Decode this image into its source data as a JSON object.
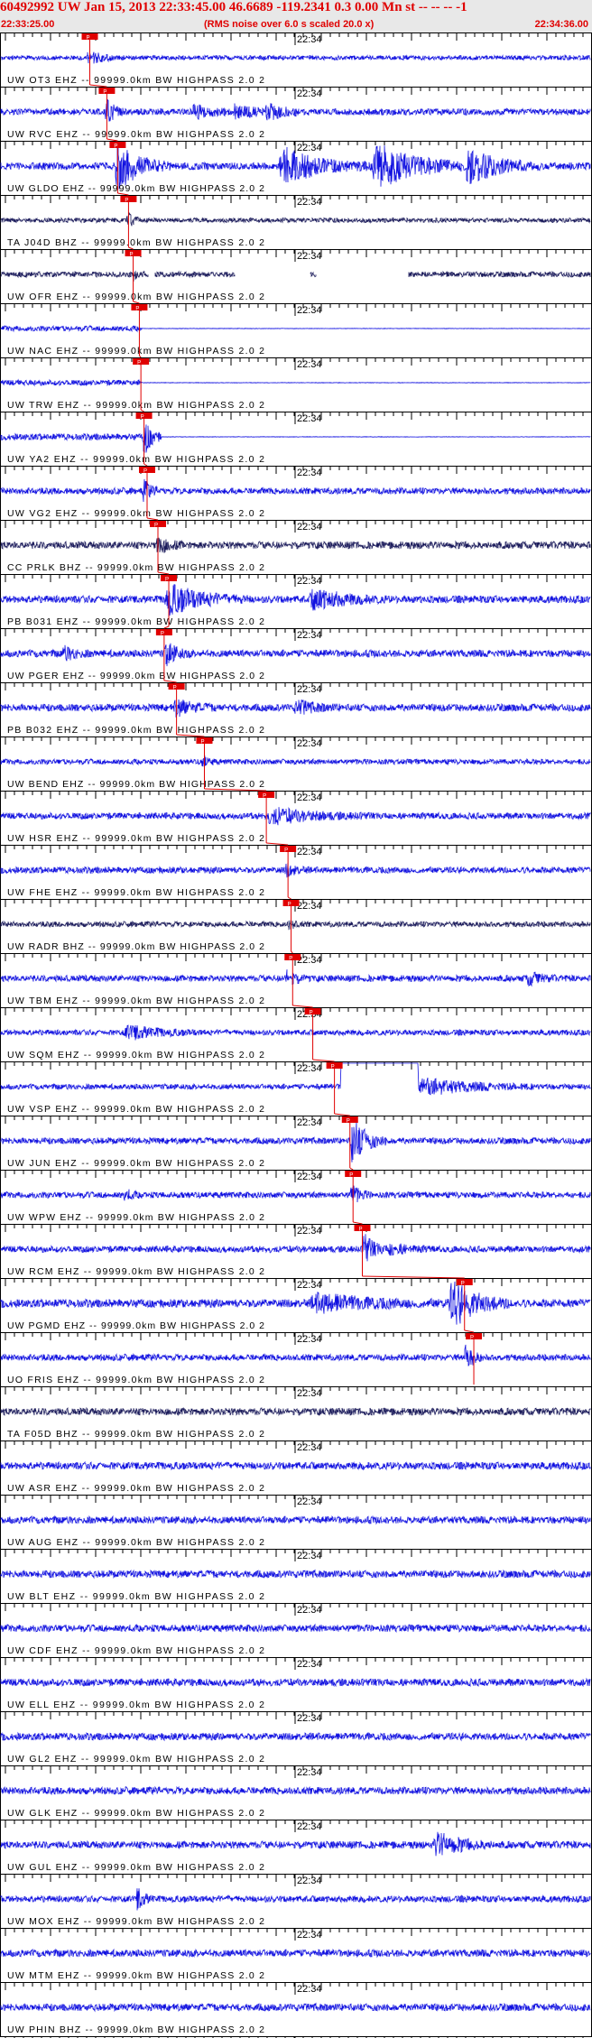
{
  "header": {
    "title": "60492992 UW Jan 15, 2013 22:33:45.00   46.6689 -119.2341  0.3 0.00 Mn st -- -- -- -1",
    "start_time": "22:33:25.00",
    "note": "(RMS noise over 6.0 s scaled 20.0 x)",
    "end_time": "22:34:36.00"
  },
  "chart_data": {
    "type": "line",
    "title": "60492992 UW Jan 15, 2013 22:33:45.00   46.6689 -119.2341  0.3 0.00 Mn st -- -- -- -1",
    "x_start": "22:33:25.00",
    "x_end": "22:34:36.00",
    "minute_label": "22:34",
    "pick_label": "P",
    "grid": false,
    "colors": {
      "trace_blue": "#1010e0",
      "trace_dark": "#1a1a5a",
      "pick": "#e00000",
      "axis": "#000000",
      "header_bg": "#e8e8e8"
    },
    "traces": [
      {
        "label": "UW OT3 EHZ -- 99999.0km BW  HIGHPASS  2.0  2",
        "pick_s": 29.0,
        "color": "blue",
        "amp": 0.25,
        "bursts": [
          [
            28,
            40,
            3.5
          ]
        ]
      },
      {
        "label": "UW RVC EHZ -- 99999.0km BW  HIGHPASS  2.0  2",
        "pick_s": 34.5,
        "color": "blue",
        "amp": 0.35,
        "bursts": [
          [
            34,
            40,
            6
          ],
          [
            62,
            76,
            2.5
          ],
          [
            75,
            90,
            3
          ],
          [
            85,
            100,
            3
          ]
        ]
      },
      {
        "label": "UW GLDO EHZ -- 99999.0km BW  HIGHPASS  2.0  2",
        "pick_s": 38.0,
        "color": "blue",
        "amp": 0.4,
        "bursts": [
          [
            37,
            55,
            8
          ],
          [
            90,
            120,
            6
          ],
          [
            120,
            155,
            7
          ],
          [
            150,
            175,
            6
          ]
        ]
      },
      {
        "label": "TA J04D BHZ -- 99999.0km BW  HIGHPASS  2.0  2",
        "pick_s": 41.5,
        "color": "dark",
        "amp": 0.25,
        "bursts": [
          [
            41,
            46,
            4
          ]
        ]
      },
      {
        "label": "UW OFR EHZ -- 99999.0km BW  HIGHPASS  2.0  2",
        "pick_s": 43.0,
        "color": "dark",
        "amp": 0.3,
        "gaps": [
          [
            48,
            50
          ],
          [
            76,
            100
          ],
          [
            102,
            132
          ]
        ],
        "bursts": [
          [
            43,
            45,
            3
          ]
        ]
      },
      {
        "label": "UW NAC EHZ -- 99999.0km BW  HIGHPASS  2.0  2",
        "pick_s": 45.0,
        "color": "blue",
        "amp": 0.3,
        "flat_after": 46
      },
      {
        "label": "UW TRW EHZ -- 99999.0km BW  HIGHPASS  2.0  2",
        "pick_s": 45.5,
        "color": "blue",
        "amp": 0.3,
        "flat_after": 46
      },
      {
        "label": "UW YA2 EHZ -- 99999.0km BW  HIGHPASS  2.0  2",
        "pick_s": 46.5,
        "color": "blue",
        "amp": 0.35,
        "flat_after": 52,
        "bursts": [
          [
            46,
            52,
            8
          ]
        ]
      },
      {
        "label": "UW VG2 EHZ -- 99999.0km BW  HIGHPASS  2.0  2",
        "pick_s": 47.5,
        "color": "blue",
        "amp": 0.35,
        "bursts": [
          [
            46,
            52,
            4
          ]
        ]
      },
      {
        "label": "CC PRLK BHZ -- 99999.0km BW  HIGHPASS  2.0  2",
        "pick_s": 51.0,
        "color": "dark",
        "amp": 0.4,
        "bursts": [
          [
            50,
            60,
            3
          ]
        ]
      },
      {
        "label": "PB B031 EHZ -- 99999.0km BW  HIGHPASS  2.0  2",
        "pick_s": 54.5,
        "color": "blue",
        "amp": 0.4,
        "bursts": [
          [
            53,
            80,
            5
          ],
          [
            100,
            125,
            3.5
          ]
        ]
      },
      {
        "label": "UW PGER EHZ -- 99999.0km BW  HIGHPASS  2.0  2",
        "pick_s": 53.0,
        "color": "blue",
        "amp": 0.4,
        "bursts": [
          [
            20,
            30,
            2
          ],
          [
            53,
            62,
            4
          ]
        ]
      },
      {
        "label": "PB B032 EHZ -- 99999.0km BW  HIGHPASS  2.0  2",
        "pick_s": 57.0,
        "color": "blue",
        "amp": 0.4,
        "bursts": [
          [
            56,
            70,
            2.5
          ],
          [
            95,
            110,
            2
          ]
        ]
      },
      {
        "label": "UW BEND EHZ -- 99999.0km BW  HIGHPASS  2.0  2",
        "pick_s": 66.0,
        "color": "blue",
        "amp": 0.3,
        "bursts": [
          [
            65,
            70,
            3
          ]
        ]
      },
      {
        "label": "UW HSR EHZ -- 99999.0km BW  HIGHPASS  2.0  2",
        "pick_s": 86.0,
        "color": "blue",
        "amp": 0.35,
        "bursts": [
          [
            86,
            120,
            2.8
          ]
        ]
      },
      {
        "label": "UW FHE EHZ -- 99999.0km BW  HIGHPASS  2.0  2",
        "pick_s": 93.0,
        "color": "blue",
        "amp": 0.35,
        "bursts": [
          [
            92,
            100,
            2
          ]
        ]
      },
      {
        "label": "UW RADR BHZ -- 99999.0km BW  HIGHPASS  2.0  2",
        "pick_s": 94.0,
        "color": "dark",
        "amp": 0.3,
        "bursts": [
          [
            93,
            98,
            2
          ]
        ]
      },
      {
        "label": "UW TBM EHZ -- 99999.0km BW  HIGHPASS  2.0  2",
        "pick_s": 94.5,
        "color": "blue",
        "amp": 0.35,
        "bursts": [
          [
            92,
            100,
            3
          ],
          [
            170,
            180,
            2.5
          ]
        ]
      },
      {
        "label": "UW SQM EHZ -- 99999.0km BW  HIGHPASS  2.0  2",
        "pick_s": 101.0,
        "color": "blue",
        "amp": 0.3,
        "bursts": [
          [
            40,
            65,
            3
          ]
        ]
      },
      {
        "label": "UW VSP EHZ -- 99999.0km BW  HIGHPASS  2.0  2",
        "pick_s": 108.0,
        "color": "blue",
        "amp": 0.3,
        "clip": [
          110,
          135
        ],
        "bursts": [
          [
            135,
            175,
            3.5
          ]
        ]
      },
      {
        "label": "UW JUN EHZ -- 99999.0km BW  HIGHPASS  2.0  2",
        "pick_s": 113.0,
        "color": "blue",
        "amp": 0.35,
        "bursts": [
          [
            113,
            125,
            9
          ]
        ]
      },
      {
        "label": "UW WPW EHZ -- 99999.0km BW  HIGHPASS  2.0  2",
        "pick_s": 114.0,
        "color": "blue",
        "amp": 0.35,
        "bursts": [
          [
            113,
            120,
            4
          ],
          [
            40,
            46,
            2
          ]
        ]
      },
      {
        "label": "UW RCM EHZ -- 99999.0km BW  HIGHPASS  2.0  2",
        "pick_s": 117.0,
        "color": "blue",
        "amp": 0.35,
        "bursts": [
          [
            117,
            125,
            6
          ],
          [
            125,
            140,
            2
          ]
        ]
      },
      {
        "label": "UW PGMD EHZ -- 99999.0km BW  HIGHPASS  2.0  2",
        "pick_s": 150.0,
        "color": "blue",
        "amp": 0.45,
        "bursts": [
          [
            100,
            145,
            2.5
          ],
          [
            145,
            165,
            7
          ]
        ]
      },
      {
        "label": "UO FRIS EHZ -- 99999.0km BW  HIGHPASS  2.0  2",
        "pick_s": 153.0,
        "color": "blue",
        "amp": 0.35,
        "bursts": [
          [
            150,
            156,
            6
          ]
        ]
      },
      {
        "label": "TA F05D BHZ -- 99999.0km BW  HIGHPASS  2.0  2",
        "color": "dark",
        "amp": 0.4
      },
      {
        "label": "UW ASR EHZ -- 99999.0km BW  HIGHPASS  2.0  2",
        "color": "blue",
        "amp": 0.4
      },
      {
        "label": "UW AUG EHZ -- 99999.0km BW  HIGHPASS  2.0  2",
        "color": "blue",
        "amp": 0.4
      },
      {
        "label": "UW BLT EHZ -- 99999.0km BW  HIGHPASS  2.0  2",
        "color": "blue",
        "amp": 0.4
      },
      {
        "label": "UW CDF EHZ -- 99999.0km BW  HIGHPASS  2.0  2",
        "color": "blue",
        "amp": 0.4
      },
      {
        "label": "UW ELL EHZ -- 99999.0km BW  HIGHPASS  2.0  2",
        "color": "blue",
        "amp": 0.4
      },
      {
        "label": "UW GL2 EHZ -- 99999.0km BW  HIGHPASS  2.0  2",
        "color": "blue",
        "amp": 0.4
      },
      {
        "label": "UW GLK EHZ -- 99999.0km BW  HIGHPASS  2.0  2",
        "color": "blue",
        "amp": 0.4
      },
      {
        "label": "UW GUL EHZ -- 99999.0km BW  HIGHPASS  2.0  2",
        "color": "blue",
        "amp": 0.4,
        "bursts": [
          [
            140,
            160,
            4
          ]
        ]
      },
      {
        "label": "UW MOX EHZ -- 99999.0km BW  HIGHPASS  2.0  2",
        "color": "blue",
        "amp": 0.35,
        "bursts": [
          [
            44,
            50,
            4
          ]
        ]
      },
      {
        "label": "UW MTM EHZ -- 99999.0km BW  HIGHPASS  2.0  2",
        "color": "blue",
        "amp": 0.4
      },
      {
        "label": "UW PHIN BHZ -- 99999.0km BW  HIGHPASS  2.0  2",
        "color": "blue",
        "amp": 0.4
      },
      {
        "label": "",
        "color": "dark",
        "amp": 0.4
      }
    ]
  }
}
